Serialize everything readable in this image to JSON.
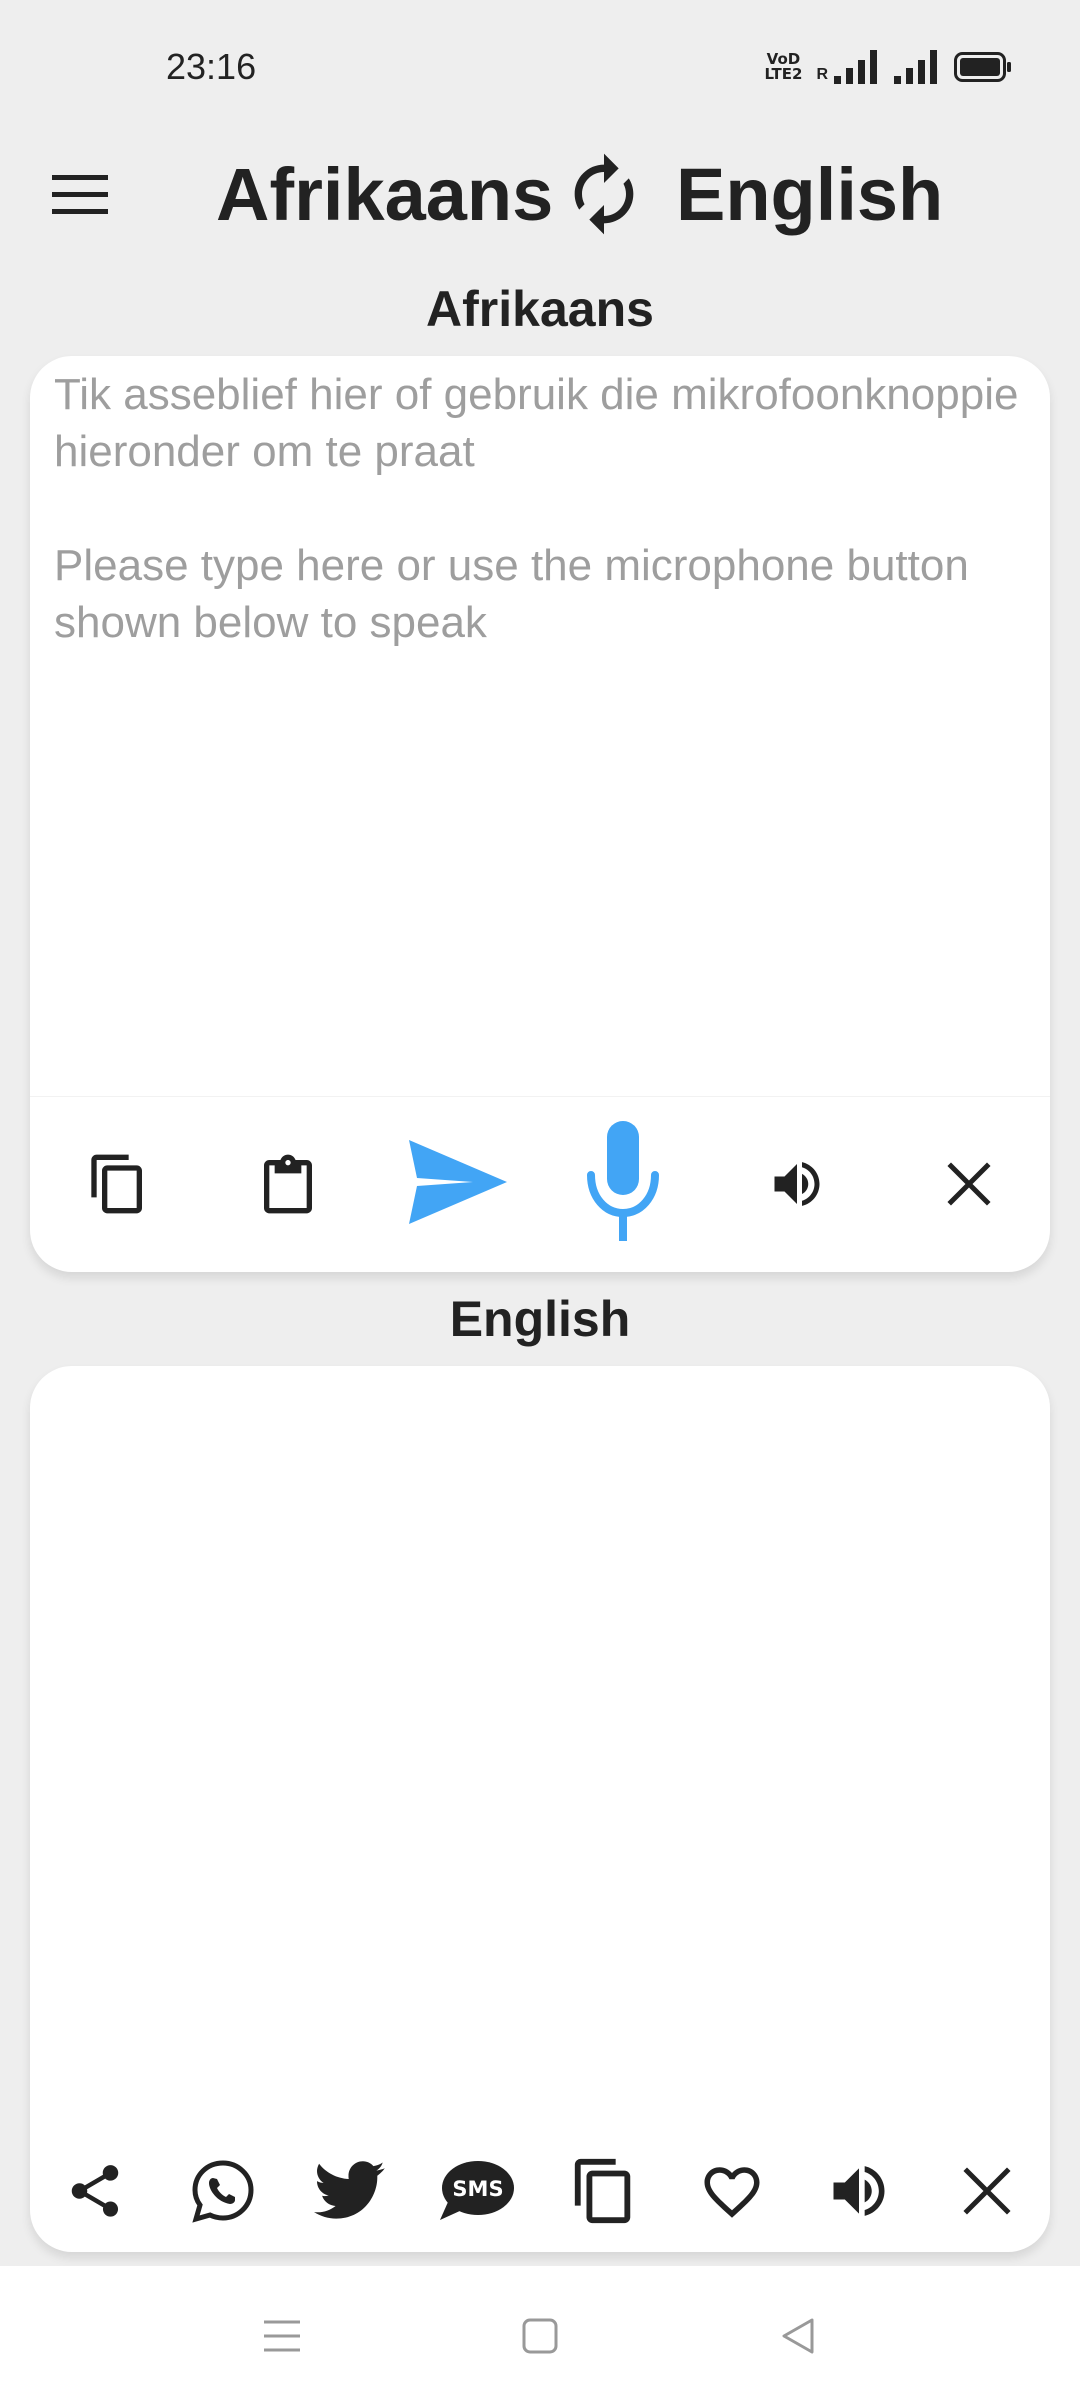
{
  "status_bar": {
    "time": "23:16",
    "volte_top": "VoD",
    "volte_bottom": "LTE2",
    "roaming": "R"
  },
  "header": {
    "source_language": "Afrikaans",
    "target_language": "English"
  },
  "input_section": {
    "label": "Afrikaans",
    "placeholder": "Tik asseblief hier of gebruik die mikrofoonknoppie hieronder om te praat\n\nPlease type here or use the microphone button shown below to speak",
    "value": ""
  },
  "output_section": {
    "label": "English",
    "value": ""
  },
  "colors": {
    "accent": "#42a5f5",
    "background": "#eeeeee",
    "card": "#ffffff",
    "text": "#222222",
    "placeholder": "#9e9e9e"
  },
  "icons": {
    "input_toolbar": [
      "copy-icon",
      "paste-icon",
      "send-icon",
      "microphone-icon",
      "speaker-icon",
      "clear-icon"
    ],
    "output_toolbar": [
      "share-icon",
      "whatsapp-icon",
      "twitter-icon",
      "sms-icon",
      "copy-icon",
      "favorite-icon",
      "speaker-icon",
      "clear-icon"
    ],
    "nav_bar": [
      "recent-apps-icon",
      "home-icon",
      "back-icon"
    ]
  }
}
